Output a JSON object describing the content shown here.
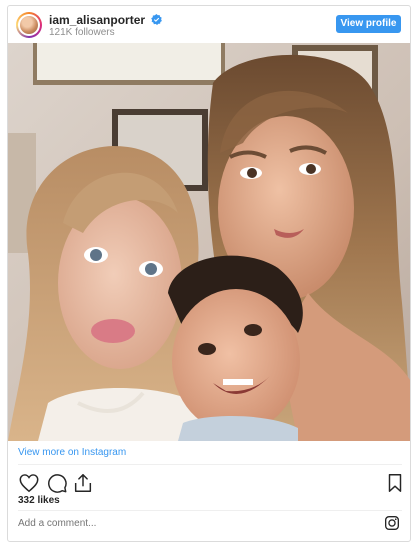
{
  "header": {
    "username": "iam_alisanporter",
    "followers": "121K followers",
    "view_profile_label": "View profile"
  },
  "footer": {
    "view_more_label": "View more on Instagram",
    "likes": "332 likes",
    "comment_placeholder": "Add a comment..."
  },
  "icons": {
    "verified": "verified-badge-icon",
    "like": "heart-icon",
    "comment": "comment-bubble-icon",
    "share": "share-icon",
    "save": "bookmark-icon",
    "instagram": "instagram-glyph-icon"
  },
  "colors": {
    "accent": "#3897f0",
    "border": "#dbdbdb",
    "muted_text": "#8e8e8e",
    "text": "#262626"
  }
}
